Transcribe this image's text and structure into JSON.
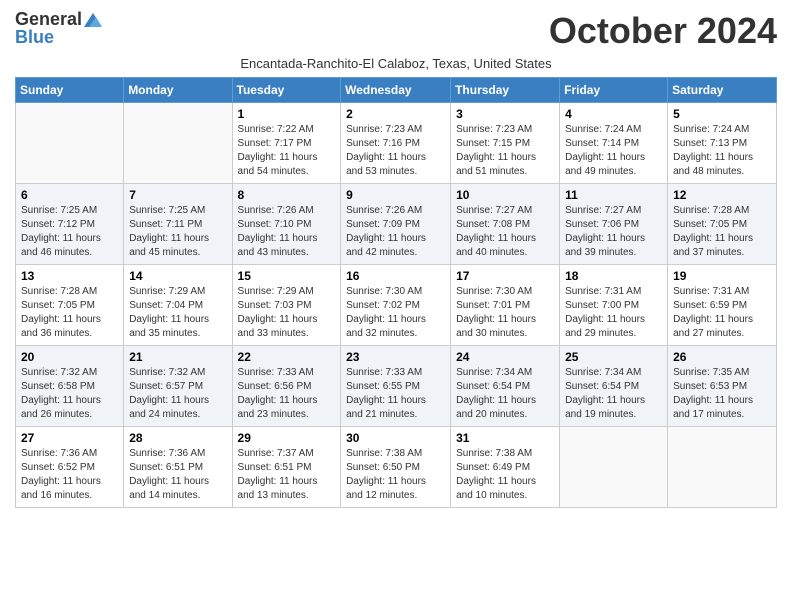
{
  "header": {
    "logo_line1": "General",
    "logo_line2": "Blue",
    "month_title": "October 2024",
    "subtitle": "Encantada-Ranchito-El Calaboz, Texas, United States"
  },
  "weekdays": [
    "Sunday",
    "Monday",
    "Tuesday",
    "Wednesday",
    "Thursday",
    "Friday",
    "Saturday"
  ],
  "weeks": [
    [
      {
        "day": "",
        "info": ""
      },
      {
        "day": "",
        "info": ""
      },
      {
        "day": "1",
        "info": "Sunrise: 7:22 AM\nSunset: 7:17 PM\nDaylight: 11 hours and 54 minutes."
      },
      {
        "day": "2",
        "info": "Sunrise: 7:23 AM\nSunset: 7:16 PM\nDaylight: 11 hours and 53 minutes."
      },
      {
        "day": "3",
        "info": "Sunrise: 7:23 AM\nSunset: 7:15 PM\nDaylight: 11 hours and 51 minutes."
      },
      {
        "day": "4",
        "info": "Sunrise: 7:24 AM\nSunset: 7:14 PM\nDaylight: 11 hours and 49 minutes."
      },
      {
        "day": "5",
        "info": "Sunrise: 7:24 AM\nSunset: 7:13 PM\nDaylight: 11 hours and 48 minutes."
      }
    ],
    [
      {
        "day": "6",
        "info": "Sunrise: 7:25 AM\nSunset: 7:12 PM\nDaylight: 11 hours and 46 minutes."
      },
      {
        "day": "7",
        "info": "Sunrise: 7:25 AM\nSunset: 7:11 PM\nDaylight: 11 hours and 45 minutes."
      },
      {
        "day": "8",
        "info": "Sunrise: 7:26 AM\nSunset: 7:10 PM\nDaylight: 11 hours and 43 minutes."
      },
      {
        "day": "9",
        "info": "Sunrise: 7:26 AM\nSunset: 7:09 PM\nDaylight: 11 hours and 42 minutes."
      },
      {
        "day": "10",
        "info": "Sunrise: 7:27 AM\nSunset: 7:08 PM\nDaylight: 11 hours and 40 minutes."
      },
      {
        "day": "11",
        "info": "Sunrise: 7:27 AM\nSunset: 7:06 PM\nDaylight: 11 hours and 39 minutes."
      },
      {
        "day": "12",
        "info": "Sunrise: 7:28 AM\nSunset: 7:05 PM\nDaylight: 11 hours and 37 minutes."
      }
    ],
    [
      {
        "day": "13",
        "info": "Sunrise: 7:28 AM\nSunset: 7:05 PM\nDaylight: 11 hours and 36 minutes."
      },
      {
        "day": "14",
        "info": "Sunrise: 7:29 AM\nSunset: 7:04 PM\nDaylight: 11 hours and 35 minutes."
      },
      {
        "day": "15",
        "info": "Sunrise: 7:29 AM\nSunset: 7:03 PM\nDaylight: 11 hours and 33 minutes."
      },
      {
        "day": "16",
        "info": "Sunrise: 7:30 AM\nSunset: 7:02 PM\nDaylight: 11 hours and 32 minutes."
      },
      {
        "day": "17",
        "info": "Sunrise: 7:30 AM\nSunset: 7:01 PM\nDaylight: 11 hours and 30 minutes."
      },
      {
        "day": "18",
        "info": "Sunrise: 7:31 AM\nSunset: 7:00 PM\nDaylight: 11 hours and 29 minutes."
      },
      {
        "day": "19",
        "info": "Sunrise: 7:31 AM\nSunset: 6:59 PM\nDaylight: 11 hours and 27 minutes."
      }
    ],
    [
      {
        "day": "20",
        "info": "Sunrise: 7:32 AM\nSunset: 6:58 PM\nDaylight: 11 hours and 26 minutes."
      },
      {
        "day": "21",
        "info": "Sunrise: 7:32 AM\nSunset: 6:57 PM\nDaylight: 11 hours and 24 minutes."
      },
      {
        "day": "22",
        "info": "Sunrise: 7:33 AM\nSunset: 6:56 PM\nDaylight: 11 hours and 23 minutes."
      },
      {
        "day": "23",
        "info": "Sunrise: 7:33 AM\nSunset: 6:55 PM\nDaylight: 11 hours and 21 minutes."
      },
      {
        "day": "24",
        "info": "Sunrise: 7:34 AM\nSunset: 6:54 PM\nDaylight: 11 hours and 20 minutes."
      },
      {
        "day": "25",
        "info": "Sunrise: 7:34 AM\nSunset: 6:54 PM\nDaylight: 11 hours and 19 minutes."
      },
      {
        "day": "26",
        "info": "Sunrise: 7:35 AM\nSunset: 6:53 PM\nDaylight: 11 hours and 17 minutes."
      }
    ],
    [
      {
        "day": "27",
        "info": "Sunrise: 7:36 AM\nSunset: 6:52 PM\nDaylight: 11 hours and 16 minutes."
      },
      {
        "day": "28",
        "info": "Sunrise: 7:36 AM\nSunset: 6:51 PM\nDaylight: 11 hours and 14 minutes."
      },
      {
        "day": "29",
        "info": "Sunrise: 7:37 AM\nSunset: 6:51 PM\nDaylight: 11 hours and 13 minutes."
      },
      {
        "day": "30",
        "info": "Sunrise: 7:38 AM\nSunset: 6:50 PM\nDaylight: 11 hours and 12 minutes."
      },
      {
        "day": "31",
        "info": "Sunrise: 7:38 AM\nSunset: 6:49 PM\nDaylight: 11 hours and 10 minutes."
      },
      {
        "day": "",
        "info": ""
      },
      {
        "day": "",
        "info": ""
      }
    ]
  ]
}
